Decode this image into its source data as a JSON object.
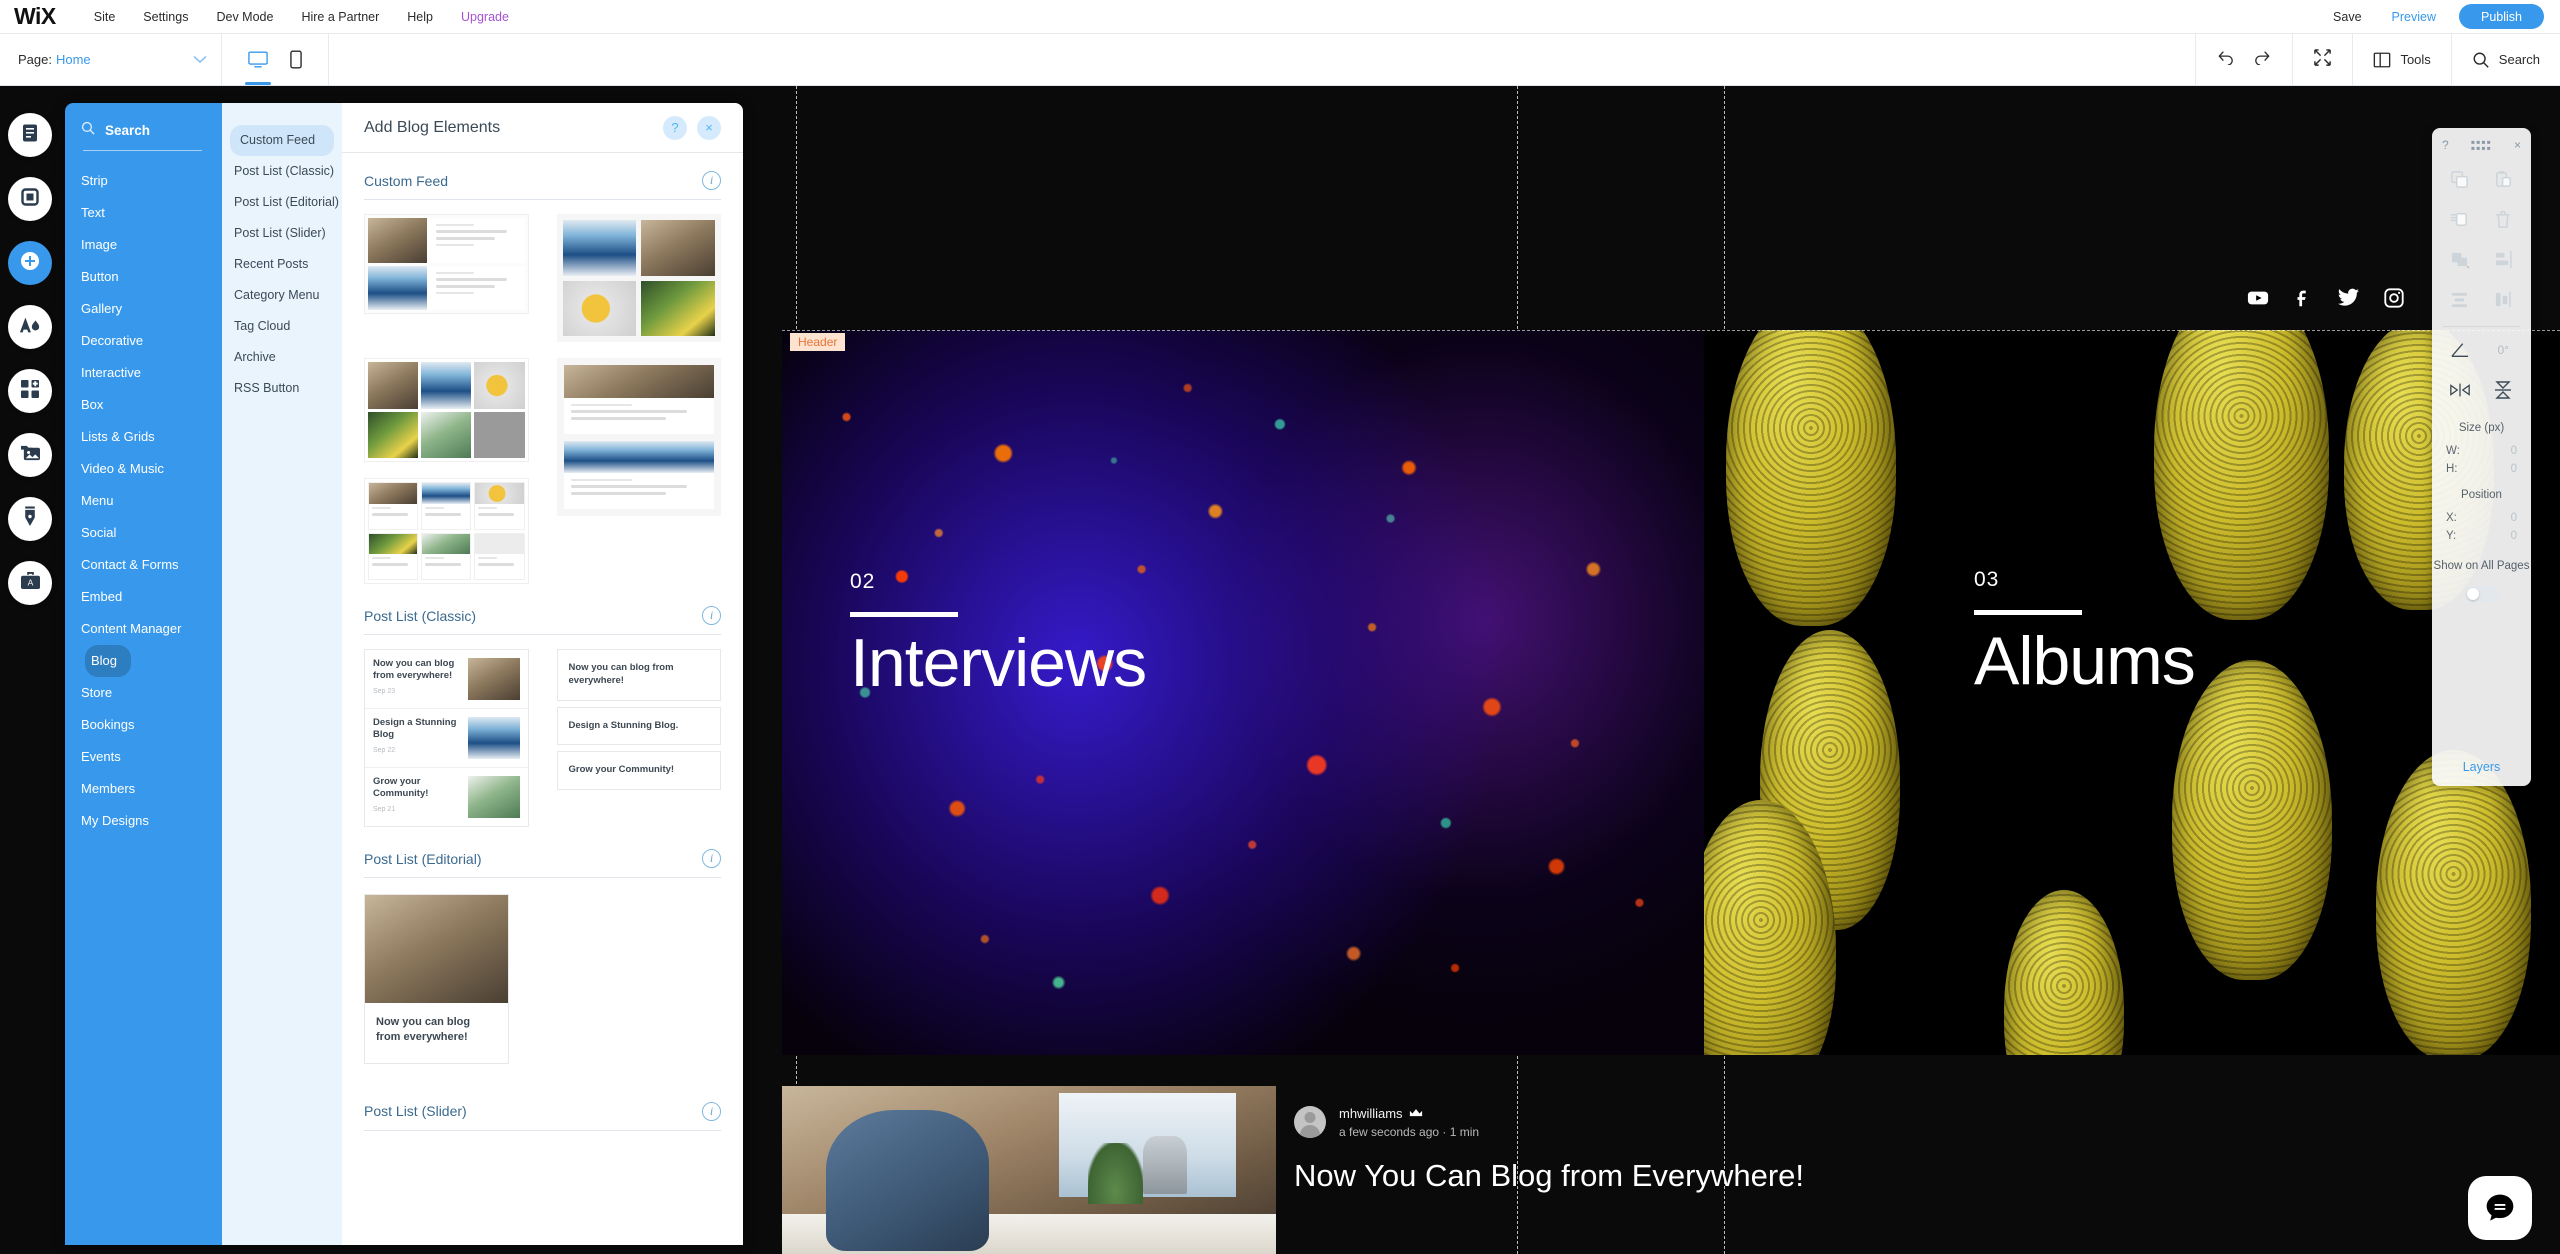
{
  "app": {
    "logo": "WiX",
    "menu": [
      "Site",
      "Settings",
      "Dev Mode",
      "Hire a Partner",
      "Help"
    ],
    "upgrade": "Upgrade",
    "save": "Save",
    "preview": "Preview",
    "publish": "Publish"
  },
  "toolbar": {
    "page_label": "Page:",
    "page_value": "Home",
    "desktop_icon": "desktop-icon",
    "mobile_icon": "mobile-icon",
    "undo_icon": "undo-icon",
    "redo_icon": "redo-icon",
    "zoomout_icon": "zoom-out-icon",
    "tools": "Tools",
    "search": "Search"
  },
  "rail": [
    {
      "name": "menus-and-pages",
      "icon": "pages-icon"
    },
    {
      "name": "background",
      "icon": "background-icon"
    },
    {
      "name": "add-elements",
      "icon": "plus-icon",
      "active": true
    },
    {
      "name": "site-design",
      "icon": "theme-icon"
    },
    {
      "name": "add-apps",
      "icon": "apps-icon"
    },
    {
      "name": "my-uploads",
      "icon": "media-icon"
    },
    {
      "name": "blog",
      "icon": "pen-icon"
    },
    {
      "name": "my-business",
      "icon": "briefcase-icon"
    }
  ],
  "categories": {
    "search_placeholder": "Search",
    "search_icon": "search-icon",
    "items": [
      "Strip",
      "Text",
      "Image",
      "Button",
      "Gallery",
      "Decorative",
      "Interactive",
      "Box",
      "Lists & Grids",
      "Video & Music",
      "Menu",
      "Social",
      "Contact & Forms",
      "Embed",
      "Content Manager",
      "Blog",
      "Store",
      "Bookings",
      "Events",
      "Members",
      "My Designs"
    ],
    "active": "Blog"
  },
  "subcategories": {
    "items": [
      "Custom Feed",
      "Post List (Classic)",
      "Post List (Editorial)",
      "Post List (Slider)",
      "Recent Posts",
      "Category Menu",
      "Tag Cloud",
      "Archive",
      "RSS Button"
    ],
    "active": "Custom Feed"
  },
  "panel": {
    "title": "Add Blog Elements",
    "help_label": "?",
    "close_label": "×",
    "sections": [
      {
        "title": "Custom Feed",
        "info": "i"
      },
      {
        "title": "Post List (Classic)",
        "info": "i"
      },
      {
        "title": "Post List (Editorial)",
        "info": "i"
      },
      {
        "title": "Post List (Slider)",
        "info": "i"
      }
    ],
    "classic_left_rows": [
      {
        "title": "Now you can blog from everywhere!",
        "date": "Sep 23"
      },
      {
        "title": "Design a Stunning Blog",
        "date": "Sep 22"
      },
      {
        "title": "Grow your Community!",
        "date": "Sep 21"
      }
    ],
    "classic_right_rows": [
      "Now you can blog from everywhere!",
      "Design a Stunning Blog.",
      "Grow your Community!"
    ],
    "editorial_card_title": "Now you can blog from everywhere!"
  },
  "canvas": {
    "header_label": "Header",
    "social_icons": [
      "youtube-icon",
      "facebook-icon",
      "twitter-icon",
      "instagram-icon"
    ],
    "hero": [
      {
        "number": "02",
        "title": "Interviews"
      },
      {
        "number": "03",
        "title": "Albums"
      }
    ],
    "post": {
      "author": "mhwilliams",
      "crown_icon": "crown-icon",
      "meta": "a few seconds ago  ·  1 min",
      "title": "Now You Can Blog from Everywhere!"
    },
    "chat_icon": "chat-bubble-icon"
  },
  "float_panel": {
    "help": "?",
    "grip_icon": "drag-grip-icon",
    "close": "×",
    "tools": [
      "duplicate-icon",
      "paste-icon",
      "copy-style-icon",
      "delete-icon",
      "arrange-icon",
      "align-icon",
      "distribute-horizontal-icon",
      "distribute-vertical-icon",
      "rotate-icon",
      "flip-horizontal-icon",
      "flip-vertical-icon"
    ],
    "rotation_value": "0°",
    "size_label": "Size (px)",
    "width_key": "W:",
    "width_value": "0",
    "height_key": "H:",
    "height_value": "0",
    "position_label": "Position",
    "x_key": "X:",
    "x_value": "0",
    "y_key": "Y:",
    "y_value": "0",
    "show_all_pages_label": "Show on All Pages",
    "layers_label": "Layers"
  },
  "colors": {
    "accent": "#3899ec",
    "upgrade": "#a653d3",
    "panel_blue": "#3899ec",
    "sub_bg": "#eaf4fd",
    "header_tag": "#e8743b"
  }
}
